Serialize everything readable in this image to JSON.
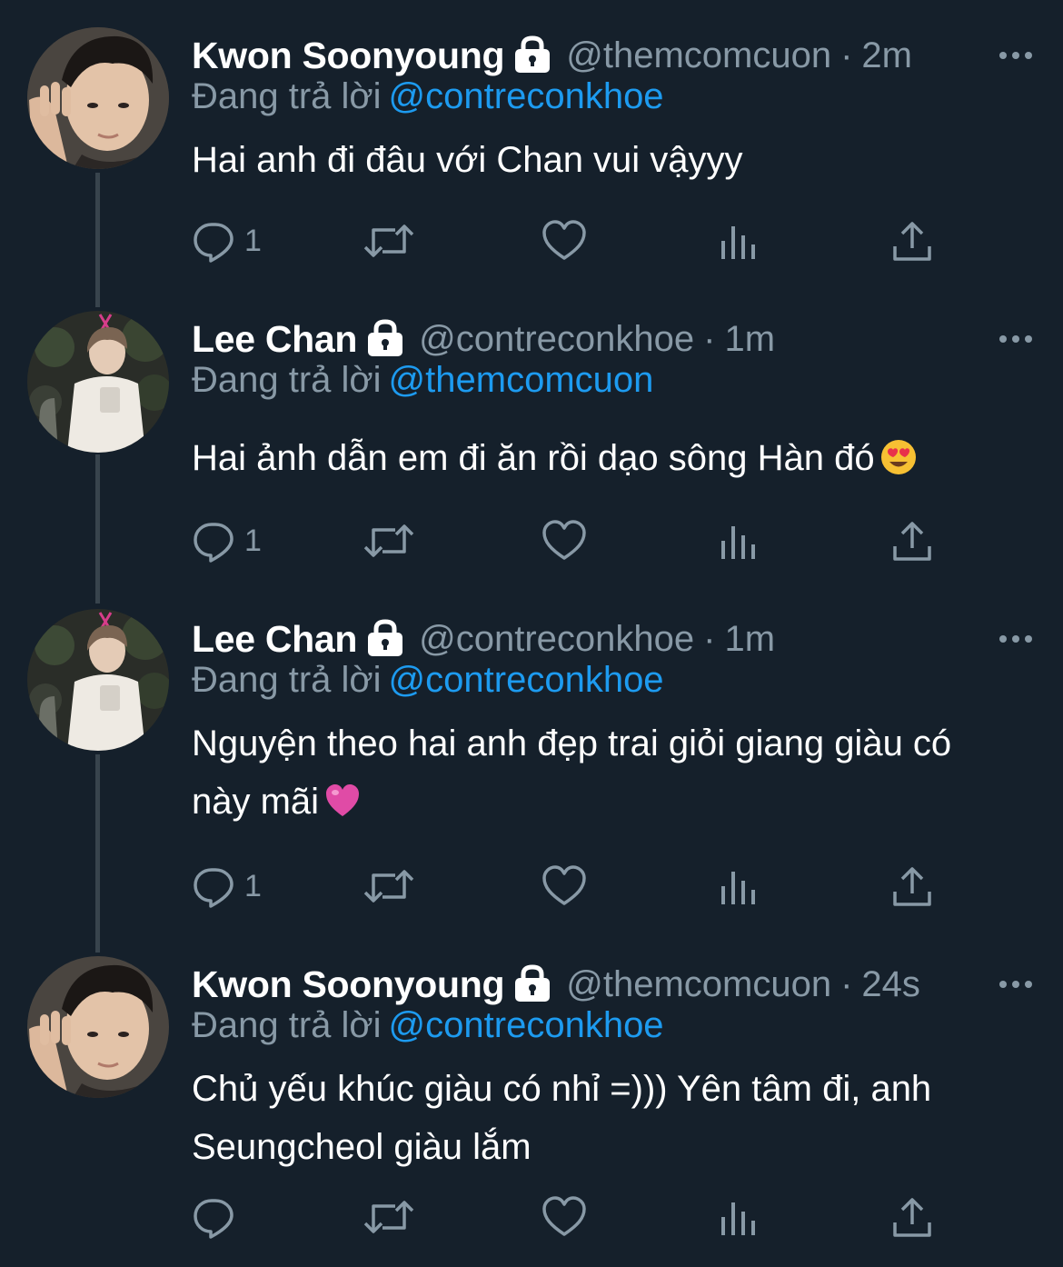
{
  "colors": {
    "background": "#15202b",
    "primary_text": "#ffffff",
    "secondary_text": "#8899a6",
    "mention": "#1d9bf0",
    "thread_line": "#38444d"
  },
  "reply_prefix": "Đang trả lời",
  "tweets": [
    {
      "display_name": "Kwon Soonyoung",
      "protected_icon": "lock-icon",
      "handle": "@themcomcuon",
      "separator": "·",
      "time": "2m",
      "reply_to": "@contreconkhoe",
      "text": "Hai anh đi đâu với Chan vui vậyyy",
      "emoji": "",
      "reply_count": "1"
    },
    {
      "display_name": "Lee Chan",
      "protected_icon": "lock-icon",
      "handle": "@contreconkhoe",
      "separator": "·",
      "time": "1m",
      "reply_to": "@themcomcuon",
      "text": "Hai ảnh dẫn em đi ăn rồi dạo sông Hàn đó",
      "emoji": "heart-eyes-emoji",
      "reply_count": "1"
    },
    {
      "display_name": "Lee Chan",
      "protected_icon": "lock-icon",
      "handle": "@contreconkhoe",
      "separator": "·",
      "time": "1m",
      "reply_to": "@contreconkhoe",
      "text": "Nguyện theo hai anh đẹp trai giỏi giang giàu có này mãi",
      "emoji": "pink-heart-emoji",
      "reply_count": "1"
    },
    {
      "display_name": "Kwon Soonyoung",
      "protected_icon": "lock-icon",
      "handle": "@themcomcuon",
      "separator": "·",
      "time": "24s",
      "reply_to": "@contreconkhoe",
      "text": "Chủ yếu khúc giàu có nhỉ =))) Yên tâm đi, anh Seungcheol giàu lắm",
      "emoji": "",
      "reply_count": ""
    }
  ],
  "action_icons": [
    "reply-icon",
    "retweet-icon",
    "like-icon",
    "analytics-icon",
    "share-icon"
  ]
}
